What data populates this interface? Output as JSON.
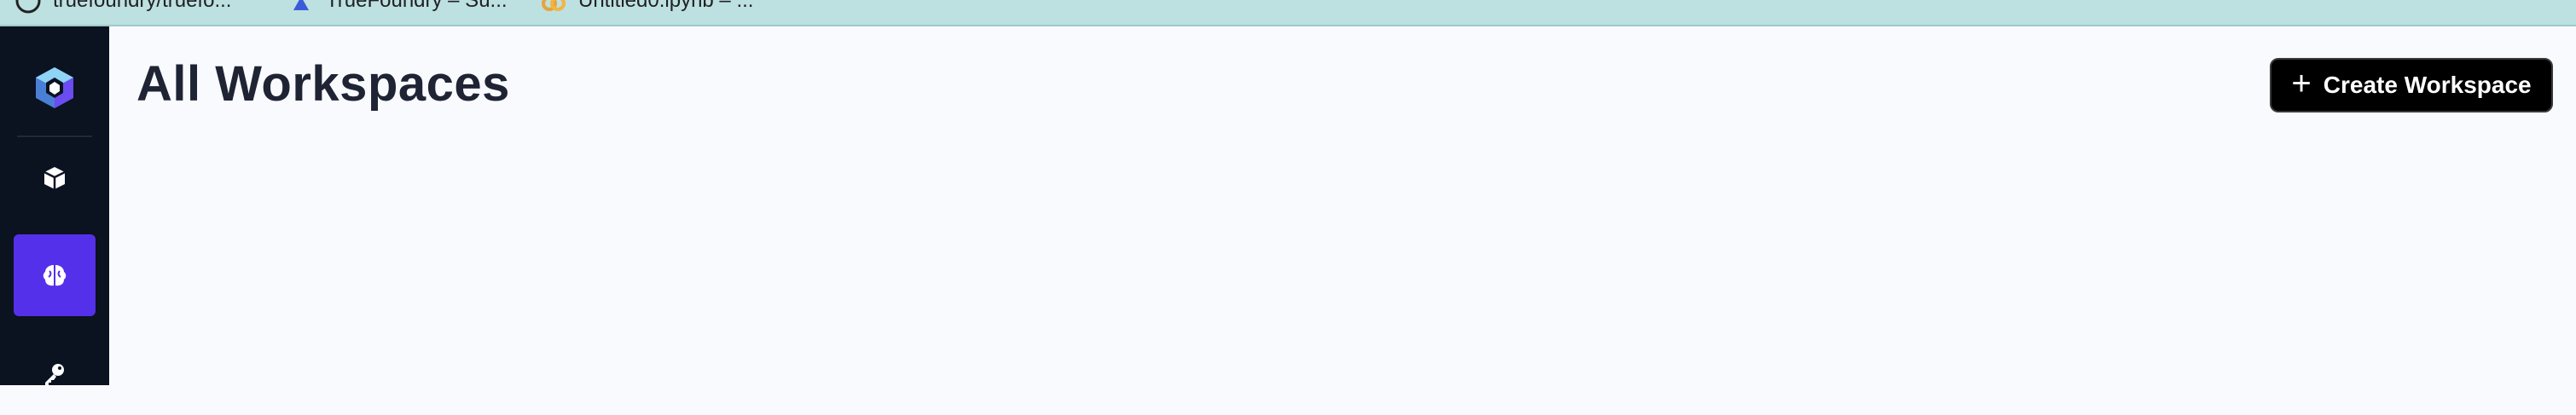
{
  "bookmarks": [
    {
      "label": "truefoundry/truefo...",
      "icon": "github-icon"
    },
    {
      "label": "TrueFoundry – Su...",
      "icon": "truefoundry-icon"
    },
    {
      "label": "Untitled0.ipynb – ...",
      "icon": "colab-icon"
    }
  ],
  "sidebar": {
    "items": [
      {
        "name": "cube-icon",
        "active": false
      },
      {
        "name": "brain-icon",
        "active": true
      },
      {
        "name": "key-icon",
        "active": false
      }
    ],
    "active_color": "#5530ea"
  },
  "main": {
    "title": "All Workspaces",
    "create_button": {
      "icon": "+",
      "label": "Create Workspace"
    }
  }
}
